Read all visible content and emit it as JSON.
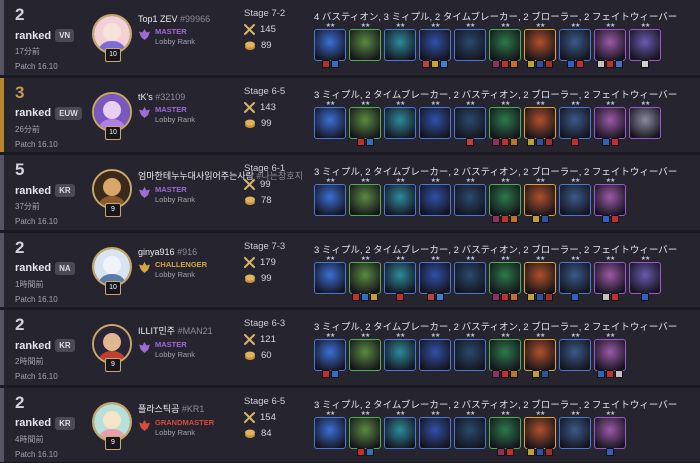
{
  "colors": {
    "row_bg": "#26252f",
    "page_bg": "#1b1a22",
    "accent_gold": "#c89b48",
    "master": "#a06ad4",
    "challenger": "#d7a442",
    "grandmaster": "#d9493c"
  },
  "matches": [
    {
      "place": "2",
      "place_color": "default",
      "mode": "ranked",
      "region": "VN",
      "ago": "17分前",
      "patch": "Patch 16.10",
      "player": {
        "name": "Top1 ZEV",
        "tag": "#99966",
        "level": "10",
        "rank": "MASTER",
        "rank_sub": "Lobby Rank",
        "rank_tier": "master"
      },
      "stage": "Stage 7-2",
      "damage": "145",
      "gold": "89",
      "traits": "4 バスティオン, 3 ミィプル, 2 タイムブレーカー, 2 ブローラー, 2 フェイトウィーバー",
      "units": [
        {
          "hue": "#3b6fd6",
          "border": "blue",
          "stars": "★★",
          "items": [
            "#b03030",
            "#3070c0"
          ]
        },
        {
          "hue": "#5a8a40",
          "border": "green",
          "stars": "★★",
          "items": []
        },
        {
          "hue": "#2d8a9c",
          "border": "blue",
          "stars": "★★",
          "items": []
        },
        {
          "hue": "#3050a8",
          "border": "blue",
          "stars": "★★",
          "items": [
            "#c04040",
            "#d0a030",
            "#4080d0"
          ]
        },
        {
          "hue": "#294a6c",
          "border": "blue",
          "stars": "★★",
          "items": []
        },
        {
          "hue": "#2c7a4a",
          "border": "green",
          "stars": "★★",
          "items": [
            "#903060",
            "#c03030",
            "#c07030"
          ]
        },
        {
          "hue": "#b0502a",
          "border": "gold",
          "stars": "★★",
          "items": [
            "#c0a030",
            "#3050a0",
            "#a03030"
          ]
        },
        {
          "hue": "#3a5a8a",
          "border": "blue",
          "stars": "★★",
          "items": [
            "#3060c0",
            "#c03030"
          ]
        },
        {
          "hue": "#9c5aa8",
          "border": "purple",
          "stars": "★★",
          "items": [
            "#c0c0c0",
            "#c03030",
            "#4070c0"
          ]
        },
        {
          "hue": "#6a5ab0",
          "border": "purple",
          "stars": "★★",
          "items": [
            "#d0d0d0"
          ]
        }
      ]
    },
    {
      "place": "3",
      "place_color": "gold",
      "mode": "ranked",
      "region": "EUW",
      "ago": "26分前",
      "patch": "Patch 16.10",
      "player": {
        "name": "tK's",
        "tag": "#32109",
        "level": "10",
        "rank": "MASTER",
        "rank_sub": "Lobby Rank",
        "rank_tier": "master"
      },
      "stage": "Stage 6-5",
      "damage": "143",
      "gold": "99",
      "traits": "3 ミィプル, 2 タイムブレーカー, 2 バスティオン, 2 ブローラー, 2 フェイトウィーバー",
      "units": [
        {
          "hue": "#3b6fd6",
          "border": "blue",
          "stars": "★★",
          "items": []
        },
        {
          "hue": "#5a8a40",
          "border": "green",
          "stars": "★★",
          "items": [
            "#c03030",
            "#3070c0"
          ]
        },
        {
          "hue": "#2d8a9c",
          "border": "blue",
          "stars": "★★",
          "items": []
        },
        {
          "hue": "#3050a8",
          "border": "blue",
          "stars": "★★",
          "items": []
        },
        {
          "hue": "#294a6c",
          "border": "blue",
          "stars": "★★",
          "items": [
            "#c04040"
          ]
        },
        {
          "hue": "#2c7a4a",
          "border": "green",
          "stars": "★★",
          "items": [
            "#903060",
            "#c03030",
            "#c07030"
          ]
        },
        {
          "hue": "#b0502a",
          "border": "gold",
          "stars": "★★",
          "items": [
            "#c0a030",
            "#3050a0",
            "#a03030"
          ]
        },
        {
          "hue": "#3a5a8a",
          "border": "blue",
          "stars": "★★",
          "items": [
            "#c03030"
          ]
        },
        {
          "hue": "#9c5aa8",
          "border": "purple",
          "stars": "★★",
          "items": [
            "#3060c0",
            "#c03030"
          ]
        },
        {
          "hue": "#8a8aa0",
          "border": "purple",
          "stars": "★★",
          "items": []
        }
      ]
    },
    {
      "place": "5",
      "place_color": "default",
      "mode": "ranked",
      "region": "KR",
      "ago": "37分前",
      "patch": "Patch 16.10",
      "player": {
        "name": "엄마한테누누대사읽어주는사람",
        "tag": "#나는창호지",
        "level": "9",
        "rank": "MASTER",
        "rank_sub": "Lobby Rank",
        "rank_tier": "master"
      },
      "stage": "Stage 6-1",
      "damage": "99",
      "gold": "78",
      "traits": "3 ミィプル, 2 タイムブレーカー, 2 バスティオン, 2 ブローラー, 2 フェイトウィーバー",
      "units": [
        {
          "hue": "#3b6fd6",
          "border": "blue",
          "stars": "★★",
          "items": []
        },
        {
          "hue": "#5a8a40",
          "border": "green",
          "stars": "★★",
          "items": []
        },
        {
          "hue": "#2d8a9c",
          "border": "blue",
          "stars": "★★",
          "items": []
        },
        {
          "hue": "#3050a8",
          "border": "blue",
          "stars": "★★",
          "items": []
        },
        {
          "hue": "#294a6c",
          "border": "blue",
          "stars": "★★",
          "items": []
        },
        {
          "hue": "#2c7a4a",
          "border": "green",
          "stars": "★★",
          "items": [
            "#903060",
            "#c03030",
            "#c07030"
          ]
        },
        {
          "hue": "#b0502a",
          "border": "gold",
          "stars": "★★",
          "items": [
            "#c0a030",
            "#3050a0"
          ]
        },
        {
          "hue": "#3a5a8a",
          "border": "blue",
          "stars": "★★",
          "items": []
        },
        {
          "hue": "#9c5aa8",
          "border": "purple",
          "stars": "★★",
          "items": [
            "#3060c0",
            "#c03030"
          ]
        }
      ]
    },
    {
      "place": "2",
      "place_color": "default",
      "mode": "ranked",
      "region": "NA",
      "ago": "1時間前",
      "patch": "Patch 16.10",
      "player": {
        "name": "ginya916",
        "tag": "#916",
        "level": "10",
        "rank": "CHALLENGER",
        "rank_sub": "Lobby Rank",
        "rank_tier": "challenger"
      },
      "stage": "Stage 7-3",
      "damage": "179",
      "gold": "99",
      "traits": "3 ミィプル, 2 タイムブレーカー, 2 バスティオン, 2 ブローラー, 2 フェイトウィーバー",
      "units": [
        {
          "hue": "#3b6fd6",
          "border": "blue",
          "stars": "★★",
          "items": []
        },
        {
          "hue": "#5a8a40",
          "border": "green",
          "stars": "★★",
          "items": [
            "#c03030",
            "#3070c0",
            "#c0a030"
          ]
        },
        {
          "hue": "#2d8a9c",
          "border": "blue",
          "stars": "★★",
          "items": [
            "#c03030"
          ]
        },
        {
          "hue": "#3050a8",
          "border": "blue",
          "stars": "★★",
          "items": [
            "#c04040",
            "#4080d0"
          ]
        },
        {
          "hue": "#294a6c",
          "border": "blue",
          "stars": "★★",
          "items": []
        },
        {
          "hue": "#2c7a4a",
          "border": "green",
          "stars": "★★",
          "items": [
            "#903060",
            "#c03030",
            "#c07030"
          ]
        },
        {
          "hue": "#b0502a",
          "border": "gold",
          "stars": "★★",
          "items": [
            "#c0a030",
            "#3050a0",
            "#a03030"
          ]
        },
        {
          "hue": "#3a5a8a",
          "border": "blue",
          "stars": "★★",
          "items": [
            "#3060c0"
          ]
        },
        {
          "hue": "#9c5aa8",
          "border": "purple",
          "stars": "★★",
          "items": [
            "#c0c0c0",
            "#c03030"
          ]
        },
        {
          "hue": "#6a5ab0",
          "border": "purple",
          "stars": "★★",
          "items": [
            "#3060c0"
          ]
        }
      ]
    },
    {
      "place": "2",
      "place_color": "default",
      "mode": "ranked",
      "region": "KR",
      "ago": "2時間前",
      "patch": "Patch 16.10",
      "player": {
        "name": "ILLIT민주",
        "tag": "#MAN21",
        "level": "9",
        "rank": "MASTER",
        "rank_sub": "Lobby Rank",
        "rank_tier": "master"
      },
      "stage": "Stage 6-3",
      "damage": "121",
      "gold": "60",
      "traits": "3 ミィプル, 2 タイムブレーカー, 2 バスティオン, 2 ブローラー, 2 フェイトウィーバー",
      "units": [
        {
          "hue": "#3b6fd6",
          "border": "blue",
          "stars": "★★",
          "items": [
            "#c03030",
            "#3070c0"
          ]
        },
        {
          "hue": "#5a8a40",
          "border": "green",
          "stars": "★★",
          "items": []
        },
        {
          "hue": "#2d8a9c",
          "border": "blue",
          "stars": "★★",
          "items": []
        },
        {
          "hue": "#3050a8",
          "border": "blue",
          "stars": "★★",
          "items": []
        },
        {
          "hue": "#294a6c",
          "border": "blue",
          "stars": "★★",
          "items": []
        },
        {
          "hue": "#2c7a4a",
          "border": "green",
          "stars": "★★",
          "items": [
            "#903060",
            "#c03030",
            "#c07030"
          ]
        },
        {
          "hue": "#b0502a",
          "border": "gold",
          "stars": "★★",
          "items": [
            "#c0a030",
            "#3050a0"
          ]
        },
        {
          "hue": "#3a5a8a",
          "border": "blue",
          "stars": "★★",
          "items": []
        },
        {
          "hue": "#9c5aa8",
          "border": "purple",
          "stars": "★★",
          "items": [
            "#3060c0",
            "#c03030",
            "#c0c0c0"
          ]
        }
      ]
    },
    {
      "place": "2",
      "place_color": "default",
      "mode": "ranked",
      "region": "KR",
      "ago": "4時間前",
      "patch": "Patch 16.10",
      "player": {
        "name": "플라스틱곰",
        "tag": "#KR1",
        "level": "9",
        "rank": "GRANDMASTER",
        "rank_sub": "Lobby Rank",
        "rank_tier": "gm"
      },
      "stage": "Stage 6-5",
      "damage": "154",
      "gold": "84",
      "traits": "3 ミィプル, 2 タイムブレーカー, 2 バスティオン, 2 ブローラー, 2 フェイトウィーバー",
      "units": [
        {
          "hue": "#3b6fd6",
          "border": "blue",
          "stars": "★★",
          "items": []
        },
        {
          "hue": "#5a8a40",
          "border": "green",
          "stars": "★★",
          "items": [
            "#c03030",
            "#3070c0"
          ]
        },
        {
          "hue": "#2d8a9c",
          "border": "blue",
          "stars": "★★",
          "items": []
        },
        {
          "hue": "#3050a8",
          "border": "blue",
          "stars": "★★",
          "items": []
        },
        {
          "hue": "#294a6c",
          "border": "blue",
          "stars": "★★",
          "items": []
        },
        {
          "hue": "#2c7a4a",
          "border": "green",
          "stars": "★★",
          "items": [
            "#903060",
            "#c03030"
          ]
        },
        {
          "hue": "#b0502a",
          "border": "gold",
          "stars": "★★",
          "items": [
            "#c0a030",
            "#3050a0",
            "#a03030"
          ]
        },
        {
          "hue": "#3a5a8a",
          "border": "blue",
          "stars": "★★",
          "items": []
        },
        {
          "hue": "#9c5aa8",
          "border": "purple",
          "stars": "★★",
          "items": [
            "#3060c0"
          ]
        }
      ]
    }
  ]
}
